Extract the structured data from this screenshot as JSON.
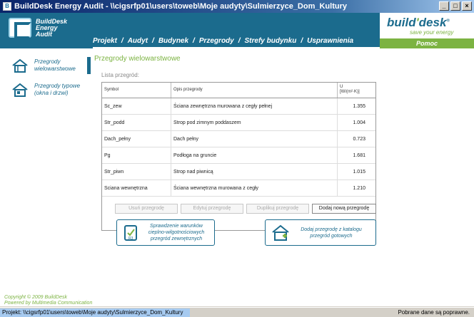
{
  "window": {
    "title": "BuildDesk Energy Audit - \\\\cigsrfp01\\users\\toweb\\Moje audyty\\Sulmierzyce_Dom_Kultury",
    "buttons": {
      "minimize": "_",
      "maximize": "□",
      "close": "×"
    }
  },
  "logo": {
    "line1": "BuildDesk",
    "line2": "Energy",
    "line3": "Audit"
  },
  "nav": {
    "items": [
      {
        "label": "Projekt"
      },
      {
        "label": "Audyt"
      },
      {
        "label": "Budynek"
      },
      {
        "label": "Przegrody"
      },
      {
        "label": "Strefy budynku"
      },
      {
        "label": "Usprawnienia"
      }
    ],
    "active": "Przegrody"
  },
  "brand": {
    "name_left": "build",
    "slash": "'",
    "name_right": "desk",
    "reg": "®",
    "tagline": "save your energy",
    "help": "Pomoc"
  },
  "sidebar": {
    "items": [
      {
        "label_line1": "Przegrody",
        "label_line2": "wielowarstwowe"
      },
      {
        "label_line1": "Przegrody typowe",
        "label_line2": "(okna i drzwi)"
      }
    ],
    "copyright_line1": "Copyright © 2009 BuildDesk",
    "copyright_line2": "Powered by Multimedia Communication"
  },
  "main": {
    "title": "Przegrody wielowarstwowe",
    "list_label": "Lista przegród:",
    "table": {
      "headers": {
        "symbol": "Symbol",
        "desc": "Opis przegrody",
        "u_line1": "U",
        "u_line2": "[W/(m²·K)]"
      },
      "rows": [
        {
          "symbol": "Sc_zew",
          "desc": "Ściana zewnętrzna murowana z cegły pełnej",
          "u": "1.355"
        },
        {
          "symbol": "Str_podd",
          "desc": "Strop pod zimnym poddaszem",
          "u": "1.004"
        },
        {
          "symbol": "Dach_pełny",
          "desc": "Dach pełny",
          "u": "0.723"
        },
        {
          "symbol": "Pg",
          "desc": "Podłoga na gruncie",
          "u": "1.681"
        },
        {
          "symbol": "Str_piwn",
          "desc": "Strop nad piwnicą",
          "u": "1.015"
        },
        {
          "symbol": "Sciana wewnętrzna",
          "desc": "Ściana wewnętrzna murowana z cegły",
          "u": "1.210"
        }
      ]
    },
    "buttons": {
      "delete": "Usuń przegrodę",
      "edit": "Edytuj przegrodę",
      "duplicate": "Duplikuj przegrodę",
      "add": "Dodaj nową przegrodę"
    },
    "check_button": {
      "line1": "Sprawdzenie warunków",
      "line2": "cieplno-wilgotnościowych",
      "line3": "przegród zewnętrznych"
    },
    "catalog_button": {
      "line1": "Dodaj przegrodę z katalogu",
      "line2": "przegród gotowych"
    }
  },
  "status": {
    "path": "Projekt: \\\\cigsrfp01\\users\\toweb\\Moje audyty\\Sulmierzyce_Dom_Kultury",
    "message": "Pobrane dane są poprawne."
  },
  "colors": {
    "header": "#1b6b8d",
    "accent_green": "#7cb342",
    "selection": "#a6caf0"
  }
}
